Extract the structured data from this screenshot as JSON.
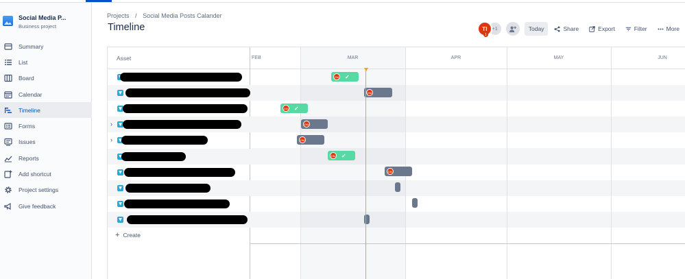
{
  "project": {
    "name": "Social Media P...",
    "type": "Business project"
  },
  "sidebar": {
    "items": [
      {
        "label": "Summary",
        "icon": "summary-icon"
      },
      {
        "label": "List",
        "icon": "list-icon"
      },
      {
        "label": "Board",
        "icon": "board-icon"
      },
      {
        "label": "Calendar",
        "icon": "calendar-icon"
      },
      {
        "label": "Timeline",
        "icon": "timeline-icon",
        "active": true
      },
      {
        "label": "Forms",
        "icon": "forms-icon"
      },
      {
        "label": "Issues",
        "icon": "issues-icon"
      },
      {
        "label": "Reports",
        "icon": "reports-icon"
      },
      {
        "label": "Add shortcut",
        "icon": "add-shortcut-icon"
      },
      {
        "label": "Project settings",
        "icon": "gear-icon"
      },
      {
        "label": "Give feedback",
        "icon": "megaphone-icon"
      }
    ]
  },
  "breadcrumb": {
    "root": "Projects",
    "separator": "/",
    "current": "Social Media Posts Calander"
  },
  "page": {
    "title": "Timeline"
  },
  "toolbar": {
    "avatar_initials": "TI",
    "avatar_badge": "1",
    "more_users": "+1",
    "today": "Today",
    "share": "Share",
    "export": "Export",
    "filter": "Filter",
    "more": "More"
  },
  "timeline": {
    "asset_header": "Asset",
    "months": [
      "FEB",
      "MAR",
      "APR",
      "MAY",
      "JUN"
    ],
    "create_label": "Create",
    "assignee_initials": "DM",
    "rows": [
      {
        "expandable": false,
        "status": "done"
      },
      {
        "expandable": false,
        "status": "todo"
      },
      {
        "expandable": false,
        "status": "done"
      },
      {
        "expandable": true,
        "status": "todo"
      },
      {
        "expandable": true,
        "status": "todo"
      },
      {
        "expandable": false,
        "status": "done"
      },
      {
        "expandable": false,
        "status": "todo"
      },
      {
        "expandable": false,
        "status": "todo"
      },
      {
        "expandable": false,
        "status": "todo"
      },
      {
        "expandable": false,
        "status": "todo"
      }
    ]
  },
  "colors": {
    "accent": "#0052cc",
    "done": "#57d9a3",
    "todo": "#6b778c",
    "today_line": "#ff991f",
    "avatar": "#de350b"
  }
}
